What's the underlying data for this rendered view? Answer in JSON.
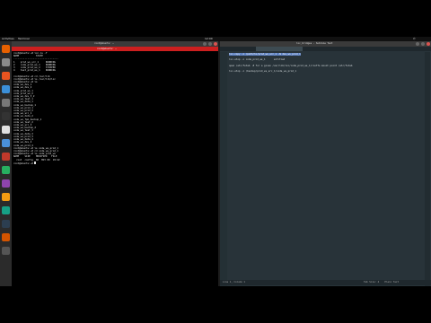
{
  "topbar": {
    "activities": "Activities",
    "app_menu": "Terminal",
    "clock": "12:00"
  },
  "dock": {
    "icons": [
      "firefox-icon",
      "files-icon",
      "software-icon",
      "help-icon",
      "settings-icon",
      "terminal-icon",
      "editor-icon",
      "app-icon",
      "app-icon",
      "app-icon",
      "app-icon",
      "app-icon",
      "app-icon",
      "app-icon",
      "app-icon",
      "show-apps-icon"
    ]
  },
  "terminal": {
    "title": "root@ubuntu: ~",
    "tab_label": "root@ubuntu: ~",
    "lines": [
      "root@ubuntu:~# lxc-ls -f",
      "NAME            STATE",
      "--------------------------------",
      "1    prod_ws_src_1     RUNNING",
      "2    code_prod_ws_1    RUNNING",
      "3    code_prod_ws_2    STOPPED",
      "4    test_prod_ws_1    RUNNING",
      "",
      "root@ubuntu:~# cd /var/lib",
      "root@ubuntu:~# ls /var/lib/lxc",
      "root@ubuntu:~# ls",
      "code_ws_dev_1",
      "code_ws_dev_2",
      "code_prod_ws_1",
      "code_prod_ws_2",
      "code_ws_dev_3_2",
      "code_ws_test_1",
      "code_ws_data_1",
      "code_ws_backup_1",
      "code_ws_prod_1",
      "code_ws_prod_2",
      "code_ws_src_1",
      "code_ws_data_2",
      "code_ws_fpm_backup_1",
      "code_ws_test_2",
      "code_ws_src_3",
      "code_ws_backup_2",
      "code_ws_test_3",
      "code_ws_data_3",
      "code_ws_prod_3",
      "code_ws_data_4",
      "code_ws_dev_4",
      "code_ws_prod_4",
      "root@ubuntu:~# ls code_ws_prod_1",
      "root@ubuntu:~# cd code_ws_prod_1",
      "root@ubuntu:~# ls code_prod_ws",
      "NAME    SIZE    MODIFIED   FILE",
      "  root  config  60  MAY 09  19:42",
      "root@ubuntu:~# "
    ]
  },
  "editor": {
    "title": "lxc_bridges - Sublime Text",
    "tab_label": "untitled",
    "lines": [
      {
        "text": "lxc-copy -n /path/to/prod_ws_src_1 -N dev_ws_prod_1",
        "selected": true
      },
      {
        "text": "",
        "selected": false
      },
      {
        "text": "lxc-stop -n code_prod_ws_1",
        "selected": false
      },
      {
        "text": "",
        "selected": false
      },
      {
        "text": "open /etc/fstab  # for a given /var/lib/lxc/code_prod_ws_1/rootfs mount point /etc/fstab",
        "selected": false
      },
      {
        "text": "",
        "selected": false
      },
      {
        "text": "lxc-stop -n /backup/prod_ws_src_1/code_ws_prod_1",
        "selected": false
      }
    ],
    "status_left": "Line 1, Column 1",
    "status_right": "Tab Size: 4    Plain Text"
  },
  "colors": {
    "terminal_tab": "#cc1f1f",
    "editor_bg": "#283339",
    "selection": "#5b7fc0"
  }
}
